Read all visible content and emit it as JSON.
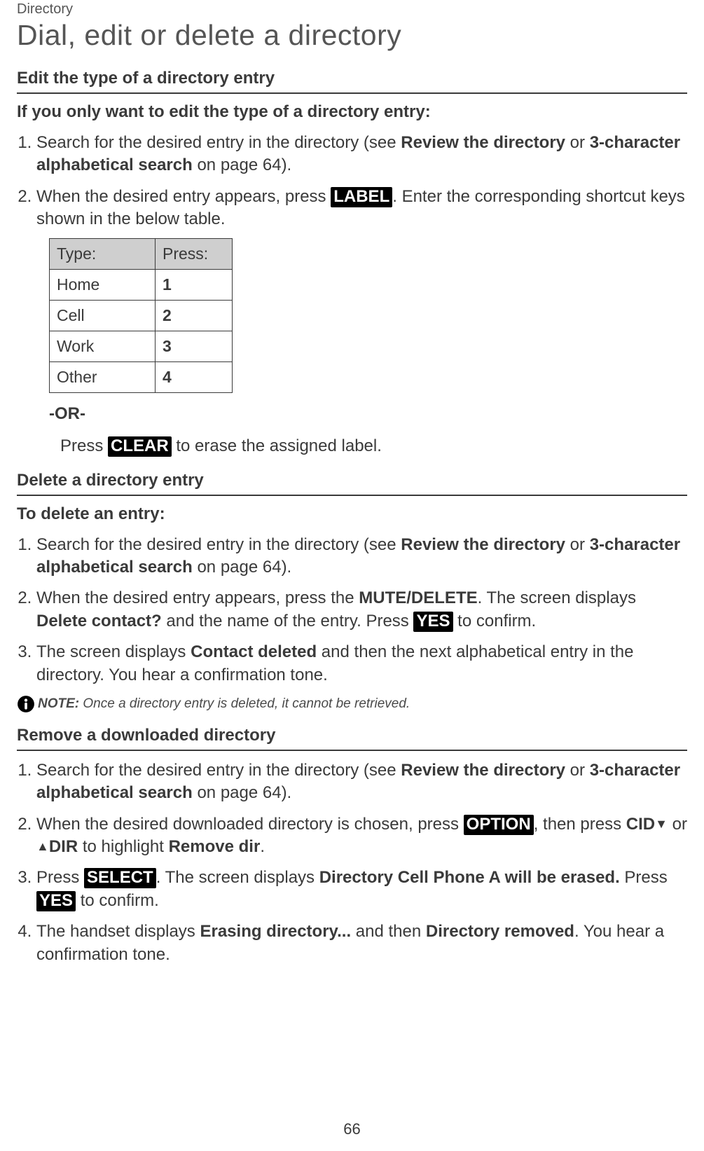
{
  "header": {
    "breadcrumb": "Directory",
    "title": "Dial, edit or delete a directory"
  },
  "sections": {
    "edit_type": {
      "heading": "Edit the type of a directory entry",
      "subhead": "If you only want to edit the type of a directory entry:",
      "step1_a": "Search for the desired entry in the directory (see ",
      "step1_b": "Review the directory",
      "step1_c": " or ",
      "step1_d": "3-character alphabetical search",
      "step1_e": " on page 64).",
      "step2_a": "When the desired entry appears, press ",
      "step2_key": "LABEL",
      "step2_b": ". Enter the corresponding shortcut keys shown in the below table.",
      "table": {
        "h1": "Type:",
        "h2": "Press:",
        "rows": [
          {
            "type": "Home",
            "press": "1"
          },
          {
            "type": "Cell",
            "press": "2"
          },
          {
            "type": "Work",
            "press": "3"
          },
          {
            "type": "Other",
            "press": "4"
          }
        ]
      },
      "or": "-OR-",
      "press_a": "Press ",
      "press_key": "CLEAR",
      "press_b": " to erase the assigned label."
    },
    "delete_entry": {
      "heading": "Delete a directory entry",
      "subhead": "To delete an entry:",
      "step1_a": "Search for the desired entry in the directory (see ",
      "step1_b": "Review the directory",
      "step1_c": " or ",
      "step1_d": "3-character alphabetical search",
      "step1_e": " on page 64).",
      "step2_a": "When the desired entry appears, press the ",
      "step2_small": "MUTE",
      "step2_bold_del": "/DELETE",
      "step2_b": ". The screen displays ",
      "step2_bold_q": "Delete contact?",
      "step2_c": " and the name of the entry. Press ",
      "step2_key": "YES",
      "step2_d": " to confirm.",
      "step3_a": "The screen displays ",
      "step3_bold": "Contact deleted",
      "step3_b": " and then the next alphabetical entry in the directory. You hear a confirmation tone.",
      "note_label": "NOTE:",
      "note_body": " Once a directory entry is deleted, it cannot be retrieved."
    },
    "remove_dir": {
      "heading": "Remove a downloaded directory",
      "step1_a": "Search for the desired entry in the directory (see ",
      "step1_b": "Review the directory",
      "step1_c": " or ",
      "step1_d": "3-character alphabetical search",
      "step1_e": " on page 64).",
      "step2_a": "When the desired downloaded directory is chosen, press ",
      "step2_key": "OPTION",
      "step2_b": ", then press ",
      "step2_bold_cid": "CID",
      "step2_c": " or ",
      "step2_bold_dir": "DIR",
      "step2_d": " to highlight ",
      "step2_bold_rem": "Remove dir",
      "step2_e": ".",
      "step3_a": "Press ",
      "step3_key": "SELECT",
      "step3_b": ". The screen displays ",
      "step3_bold": "Directory Cell Phone A will be erased.",
      "step3_c": " Press ",
      "step3_key2": "YES",
      "step3_d": " to confirm.",
      "step4_a": "The handset displays ",
      "step4_bold1": "Erasing directory...",
      "step4_b": " and then ",
      "step4_bold2": "Directory removed",
      "step4_c": ". You hear a confirmation tone."
    }
  },
  "footer": {
    "page_number": "66"
  }
}
